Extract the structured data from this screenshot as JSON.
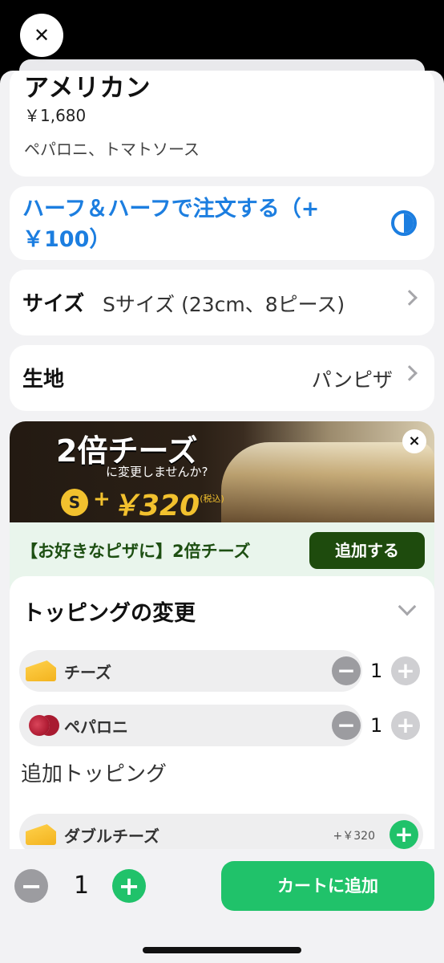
{
  "product": {
    "name": "アメリカン",
    "price": "￥1,680",
    "description": "ペパロニ、トマトソース"
  },
  "half_and_half": {
    "label": "ハーフ＆ハーフで注文する（+￥100）",
    "icon": "half-circle-icon"
  },
  "size": {
    "label": "サイズ",
    "value": "Sサイズ (23cm、8ピース)"
  },
  "crust": {
    "label": "生地",
    "value": "パンピザ"
  },
  "promo": {
    "banner_title": "2倍チーズ",
    "banner_subtitle": "に変更しませんか?",
    "banner_size": "S",
    "banner_plus": "+",
    "banner_price": "￥320",
    "banner_tax": "~(税込)",
    "text": "【お好きなピザに】2倍チーズ",
    "button": "追加する"
  },
  "toppings": {
    "title": "トッピングの変更",
    "items": [
      {
        "name": "チーズ",
        "qty": "1",
        "icon": "cheese-icon"
      },
      {
        "name": "ペパロニ",
        "qty": "1",
        "icon": "pepperoni-icon"
      }
    ],
    "extra_label": "追加トッピング",
    "extras": [
      {
        "name": "ダブルチーズ",
        "price": "+￥320",
        "icon": "cheese-icon"
      }
    ]
  },
  "bottom": {
    "qty": "1",
    "cart_button": "カートに追加"
  },
  "colors": {
    "accent_blue": "#1c7ee0",
    "green": "#20c26a",
    "dark_green": "#1e4b0d"
  }
}
